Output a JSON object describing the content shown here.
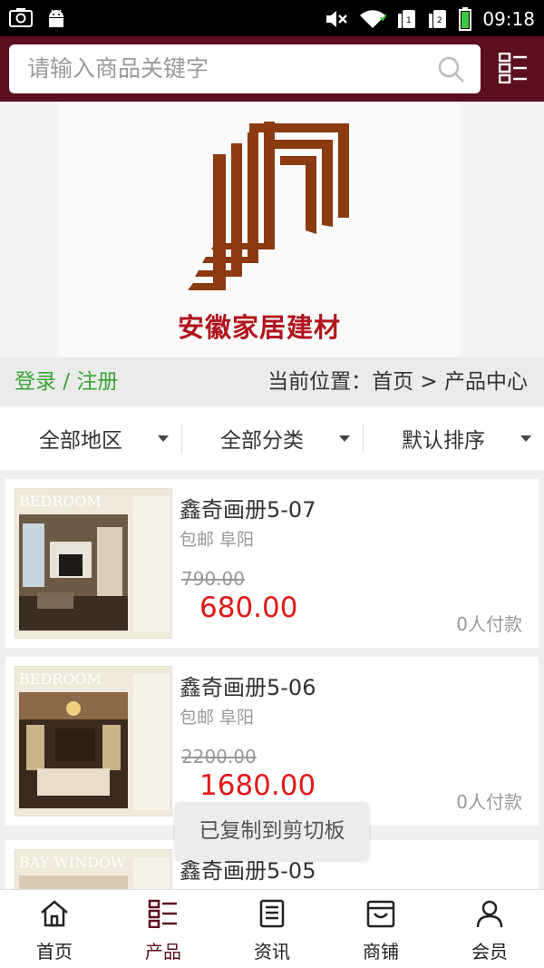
{
  "status_bar": {
    "time": "09:18",
    "left_icons": [
      "screenshot-icon",
      "android-icon"
    ],
    "right_icons": [
      "mute-icon",
      "wifi-icon",
      "sim1-icon",
      "sim2-icon",
      "battery-icon"
    ]
  },
  "header": {
    "search_placeholder": "请输入商品关键字",
    "bg_color": "#5b0f1f"
  },
  "banner": {
    "brand_name": "安徽家居建材",
    "logo_color": "#8b3a12"
  },
  "location_bar": {
    "login_register": "登录 / 注册",
    "breadcrumb": "当前位置：首页 > 产品中心"
  },
  "filters": [
    {
      "label": "全部地区"
    },
    {
      "label": "全部分类"
    },
    {
      "label": "默认排序"
    }
  ],
  "products": [
    {
      "name": "鑫奇画册5-07",
      "tags": "包邮 阜阳",
      "old_price": "790.00",
      "price": "680.00",
      "paid": "0人付款",
      "thumb_caption": "BEDROOM"
    },
    {
      "name": "鑫奇画册5-06",
      "tags": "包邮 阜阳",
      "old_price": "2200.00",
      "price": "1680.00",
      "paid": "0人付款",
      "thumb_caption": "BEDROOM"
    },
    {
      "name": "鑫奇画册5-05",
      "tags": "",
      "old_price": "",
      "price": "",
      "paid": "",
      "thumb_caption": "BAY WINDOW"
    }
  ],
  "toast": "已复制到剪切板",
  "bottom_nav": [
    {
      "label": "首页",
      "icon": "home-icon",
      "active": false
    },
    {
      "label": "产品",
      "icon": "product-list-icon",
      "active": true
    },
    {
      "label": "资讯",
      "icon": "news-icon",
      "active": false
    },
    {
      "label": "商铺",
      "icon": "shop-icon",
      "active": false
    },
    {
      "label": "会员",
      "icon": "member-icon",
      "active": false
    }
  ],
  "colors": {
    "accent": "#5b0f1f",
    "price": "#e01919",
    "login": "#3aa637"
  }
}
